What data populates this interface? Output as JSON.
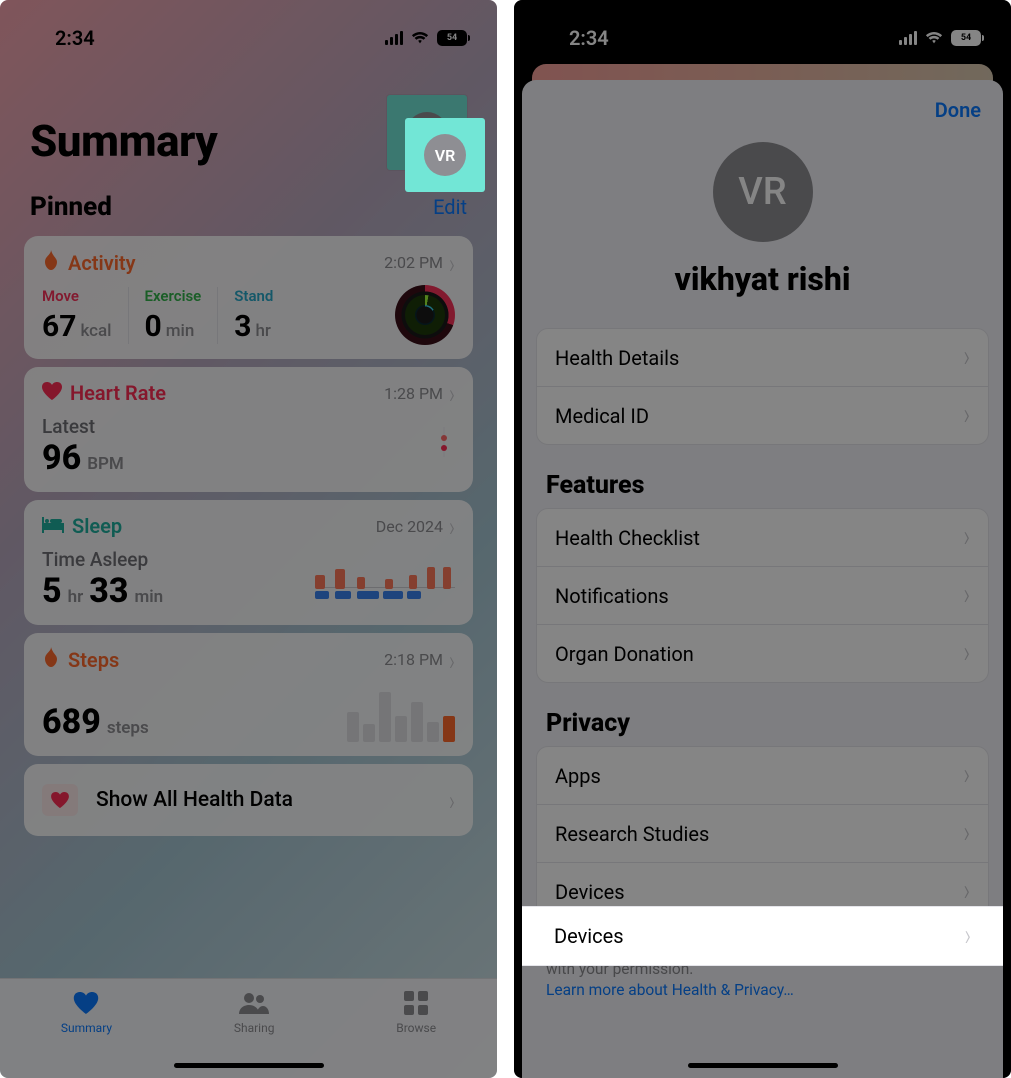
{
  "status": {
    "time": "2:34",
    "battery": "54"
  },
  "left": {
    "title": "Summary",
    "avatar_initials": "VR",
    "pinned_label": "Pinned",
    "edit_label": "Edit",
    "activity": {
      "title": "Activity",
      "timestamp": "2:02 PM",
      "move_label": "Move",
      "move_value": "67",
      "move_unit": "kcal",
      "move_color": "#fa325a",
      "exercise_label": "Exercise",
      "exercise_value": "0",
      "exercise_unit": "min",
      "exercise_color": "#32d74b",
      "stand_label": "Stand",
      "stand_value": "3",
      "stand_unit": "hr",
      "stand_color": "#2aa9c9"
    },
    "heart_rate": {
      "title": "Heart Rate",
      "timestamp": "1:28 PM",
      "latest_label": "Latest",
      "value": "96",
      "unit": "BPM"
    },
    "sleep": {
      "title": "Sleep",
      "timestamp": "Dec 2024",
      "metric_label": "Time Asleep",
      "hours": "5",
      "hours_unit": "hr",
      "minutes": "33",
      "minutes_unit": "min"
    },
    "steps": {
      "title": "Steps",
      "timestamp": "2:18 PM",
      "value": "689",
      "unit": "steps"
    },
    "show_all_label": "Show All Health Data",
    "tabs": {
      "summary": "Summary",
      "sharing": "Sharing",
      "browse": "Browse"
    }
  },
  "right": {
    "done_label": "Done",
    "avatar_initials": "VR",
    "profile_name": "vikhyat rishi",
    "group1": {
      "health_details": "Health Details",
      "medical_id": "Medical ID"
    },
    "features_title": "Features",
    "group2": {
      "checklist": "Health Checklist",
      "notifications": "Notifications",
      "organ": "Organ Donation"
    },
    "privacy_title": "Privacy",
    "group3": {
      "apps": "Apps",
      "research": "Research Studies",
      "devices": "Devices"
    },
    "note_line1": "Your data is encrypted on your device and can only be shared with your permission.",
    "note_link": "Learn more about Health & Privacy…"
  }
}
